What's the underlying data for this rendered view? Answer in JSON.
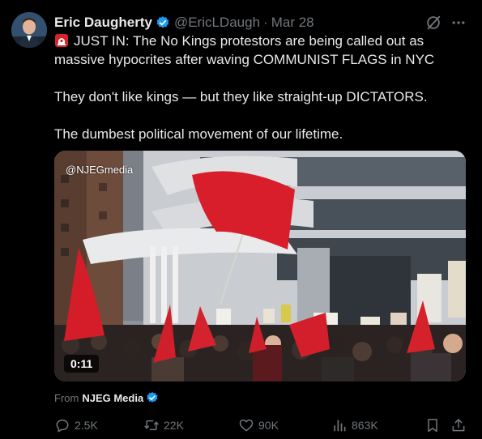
{
  "tweet": {
    "author_name": "Eric Daugherty",
    "handle": "@EricLDaugh",
    "separator": "·",
    "date": "Mar 28",
    "lines": [
      "JUST IN: The No Kings protestors are being called out as massive hypocrites after waving COMMUNIST FLAGS in NYC",
      "They don't like kings — but they like straight-up DICTATORS.",
      "The dumbest political movement of our lifetime."
    ],
    "lead_icon": "police-siren-emoji"
  },
  "media": {
    "watermark": "@NJEGmedia",
    "duration": "0:11"
  },
  "source": {
    "prefix": "From",
    "name": "NJEG Media"
  },
  "actions": {
    "replies": "2.5K",
    "reposts": "22K",
    "likes": "90K",
    "views": "863K"
  },
  "colors": {
    "background": "#000000",
    "text": "#e7e9ea",
    "muted": "#71767b",
    "verified": "#1d9bf0"
  }
}
